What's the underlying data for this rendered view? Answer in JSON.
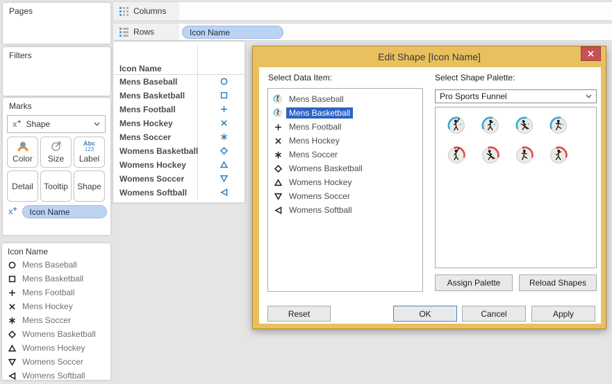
{
  "shelves": {
    "columns": {
      "label": "Columns"
    },
    "rows": {
      "label": "Rows",
      "pill": "Icon Name"
    }
  },
  "sidebar": {
    "pages": {
      "label": "Pages"
    },
    "filters": {
      "label": "Filters"
    },
    "marks": {
      "label": "Marks",
      "mark_type": "Shape",
      "buttons_row1": [
        {
          "label": "Color"
        },
        {
          "label": "Size"
        },
        {
          "label": "Label"
        }
      ],
      "buttons_row2": [
        {
          "label": "Detail"
        },
        {
          "label": "Tooltip"
        },
        {
          "label": "Shape"
        }
      ],
      "label_icon_abc": "Abc",
      "label_icon_123": "123",
      "shape_pill": "Icon Name"
    },
    "legend": {
      "title": "Icon Name",
      "items": [
        {
          "label": "Mens Baseball",
          "shape": "circle"
        },
        {
          "label": "Mens Basketball",
          "shape": "square"
        },
        {
          "label": "Mens Football",
          "shape": "plus"
        },
        {
          "label": "Mens Hockey",
          "shape": "cross"
        },
        {
          "label": "Mens Soccer",
          "shape": "asterisk"
        },
        {
          "label": "Womens Basketball",
          "shape": "diamond"
        },
        {
          "label": "Womens Hockey",
          "shape": "triangle-up"
        },
        {
          "label": "Womens Soccer",
          "shape": "triangle-down"
        },
        {
          "label": "Womens Softball",
          "shape": "triangle-left"
        }
      ]
    }
  },
  "table": {
    "header": "Icon Name",
    "shape_color": "#2e7cb8",
    "rows": [
      {
        "label": "Mens Baseball",
        "shape": "circle"
      },
      {
        "label": "Mens Basketball",
        "shape": "square"
      },
      {
        "label": "Mens Football",
        "shape": "plus"
      },
      {
        "label": "Mens Hockey",
        "shape": "cross"
      },
      {
        "label": "Mens Soccer",
        "shape": "asterisk"
      },
      {
        "label": "Womens Basketball",
        "shape": "diamond"
      },
      {
        "label": "Womens Hockey",
        "shape": "triangle-up"
      },
      {
        "label": "Womens Soccer",
        "shape": "triangle-down"
      },
      {
        "label": "Womens Softball",
        "shape": "triangle-left"
      }
    ]
  },
  "dialog": {
    "title": "Edit Shape [Icon Name]",
    "select_data_item_label": "Select Data Item:",
    "select_palette_label": "Select Shape Palette:",
    "palette_value": "Pro Sports Funnel",
    "items": [
      {
        "label": "Mens Baseball",
        "icon": "funnel",
        "sport": "baseball",
        "arc": "blue",
        "selected": false
      },
      {
        "label": "Mens Basketball",
        "icon": "funnel",
        "sport": "basketball",
        "arc": "blue",
        "selected": true
      },
      {
        "label": "Mens Football",
        "icon": "shape",
        "shape": "plus",
        "selected": false
      },
      {
        "label": "Mens Hockey",
        "icon": "shape",
        "shape": "cross",
        "selected": false
      },
      {
        "label": "Mens Soccer",
        "icon": "shape",
        "shape": "asterisk",
        "selected": false
      },
      {
        "label": "Womens Basketball",
        "icon": "shape",
        "shape": "diamond",
        "selected": false
      },
      {
        "label": "Womens Hockey",
        "icon": "shape",
        "shape": "triangle-up",
        "selected": false
      },
      {
        "label": "Womens Soccer",
        "icon": "shape",
        "shape": "triangle-down",
        "selected": false
      },
      {
        "label": "Womens Softball",
        "icon": "shape",
        "shape": "triangle-left",
        "selected": false
      }
    ],
    "palette_icons": [
      {
        "sport": "baseball",
        "arc": "blue"
      },
      {
        "sport": "basketball",
        "arc": "blue"
      },
      {
        "sport": "hockey",
        "arc": "blue"
      },
      {
        "sport": "soccer",
        "arc": "blue"
      },
      {
        "sport": "softball",
        "arc": "red"
      },
      {
        "sport": "hockey",
        "arc": "red"
      },
      {
        "sport": "soccer",
        "arc": "red"
      },
      {
        "sport": "basketball",
        "arc": "red"
      }
    ],
    "buttons": {
      "assign_palette": "Assign Palette",
      "reload_shapes": "Reload Shapes",
      "reset": "Reset",
      "ok": "OK",
      "cancel": "Cancel",
      "apply": "Apply"
    },
    "colors": {
      "frame": "#e9c05e",
      "close_bg": "#c75050",
      "selection": "#2f63c5",
      "arc_blue": "#2aabdf",
      "arc_red": "#e64545",
      "legend_shape": "#1a1a1a"
    }
  }
}
